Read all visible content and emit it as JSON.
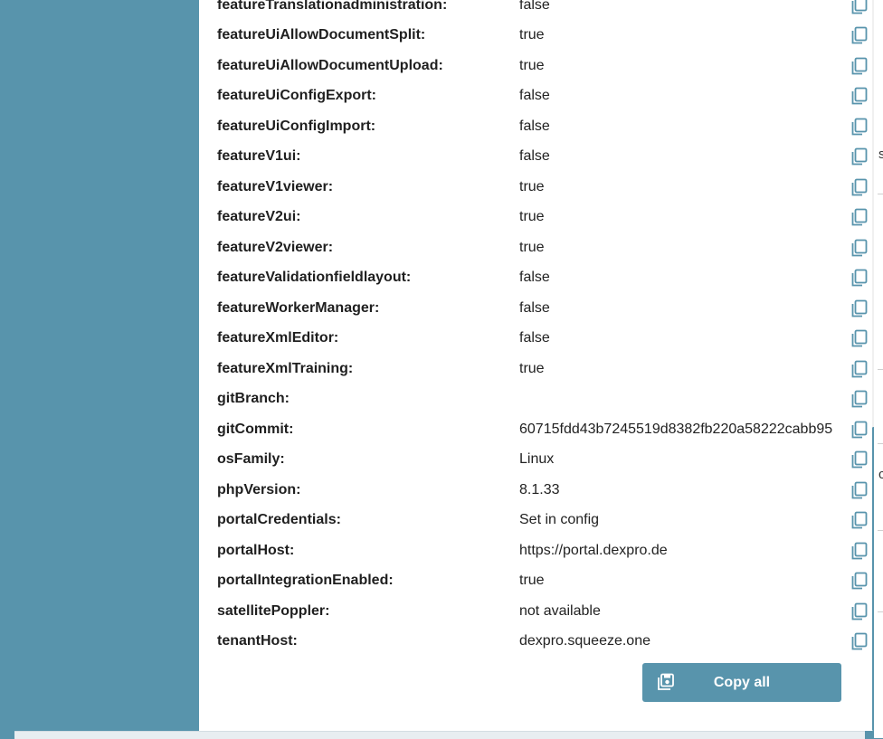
{
  "config_list": {
    "rows": [
      {
        "key": "featureTranslationadministration:",
        "value": "false"
      },
      {
        "key": "featureUiAllowDocumentSplit:",
        "value": "true"
      },
      {
        "key": "featureUiAllowDocumentUpload:",
        "value": "true"
      },
      {
        "key": "featureUiConfigExport:",
        "value": "false"
      },
      {
        "key": "featureUiConfigImport:",
        "value": "false"
      },
      {
        "key": "featureV1ui:",
        "value": "false"
      },
      {
        "key": "featureV1viewer:",
        "value": "true"
      },
      {
        "key": "featureV2ui:",
        "value": "true"
      },
      {
        "key": "featureV2viewer:",
        "value": "true"
      },
      {
        "key": "featureValidationfieldlayout:",
        "value": "false"
      },
      {
        "key": "featureWorkerManager:",
        "value": "false"
      },
      {
        "key": "featureXmlEditor:",
        "value": "false"
      },
      {
        "key": "featureXmlTraining:",
        "value": "true"
      },
      {
        "key": "gitBranch:",
        "value": ""
      },
      {
        "key": "gitCommit:",
        "value": "60715fdd43b7245519d8382fb220a58222cabb95"
      },
      {
        "key": "osFamily:",
        "value": "Linux"
      },
      {
        "key": "phpVersion:",
        "value": "8.1.33"
      },
      {
        "key": "portalCredentials:",
        "value": "Set in config"
      },
      {
        "key": "portalHost:",
        "value": "https://portal.dexpro.de"
      },
      {
        "key": "portalIntegrationEnabled:",
        "value": "true"
      },
      {
        "key": "satellitePoppler:",
        "value": "not available"
      },
      {
        "key": "tenantHost:",
        "value": "dexpro.squeeze.one"
      }
    ],
    "copy_icon": "copy-icon"
  },
  "actions": {
    "copy_all_label": "Copy all",
    "copy_all_icon": "save-icon"
  },
  "background": {
    "edge_text": [
      "s",
      "c"
    ]
  },
  "colors": {
    "accent": "#5894ac",
    "dialog_bg": "#ffffff",
    "text": "#1f1f1f"
  }
}
